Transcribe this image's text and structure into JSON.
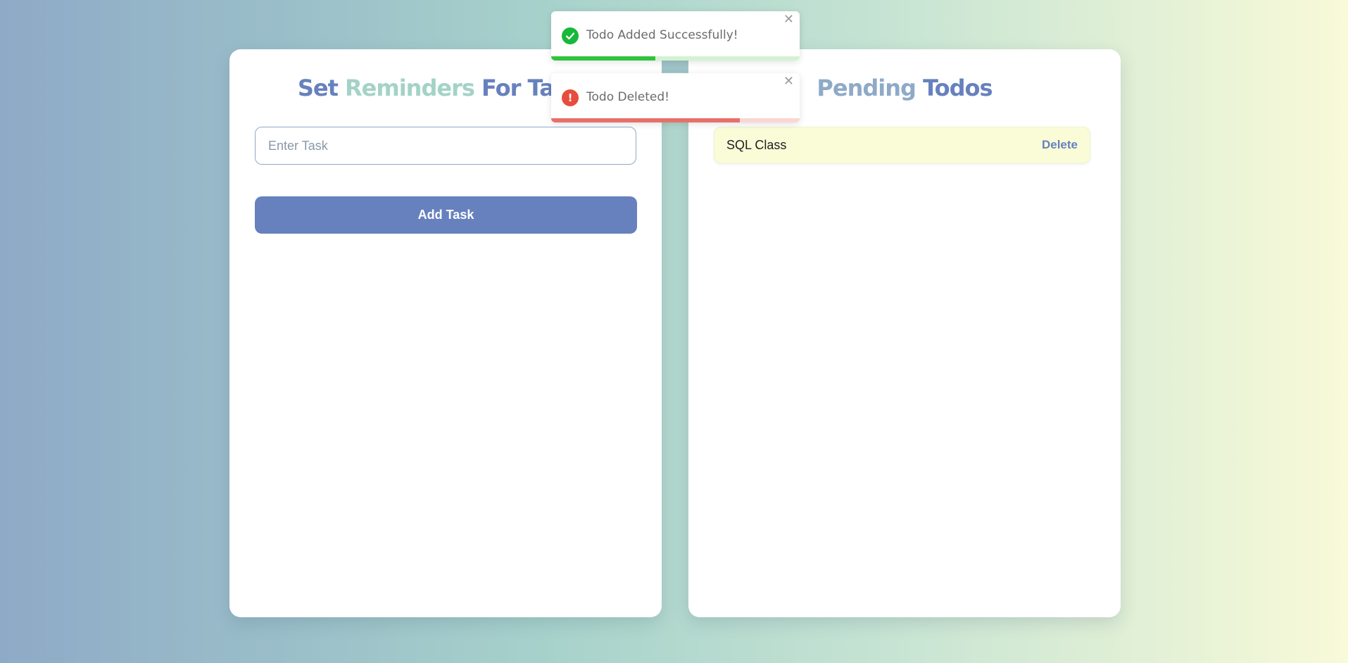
{
  "colors": {
    "accent_blue": "#6781be",
    "accent_mint": "#a3d3c6",
    "accent_slate": "#8eaac7",
    "todo_bg": "#fafcd8",
    "success": "#18b83a",
    "error": "#e74c3c"
  },
  "left_panel": {
    "title_parts": [
      "Set",
      "Reminders",
      "For Tasks"
    ],
    "input_placeholder": "Enter Task",
    "input_value": "",
    "add_button_label": "Add Task"
  },
  "right_panel": {
    "title_parts": [
      "Pending",
      "Todos"
    ],
    "todos": [
      {
        "text": "SQL Class",
        "delete_label": "Delete"
      }
    ]
  },
  "toasts": [
    {
      "type": "success",
      "icon": "check-circle-icon",
      "message": "Todo Added Successfully!",
      "close_glyph": "✕",
      "progress": 0.42
    },
    {
      "type": "error",
      "icon": "exclamation-circle-icon",
      "message": "Todo Deleted!",
      "close_glyph": "✕",
      "progress": 0.76
    }
  ]
}
